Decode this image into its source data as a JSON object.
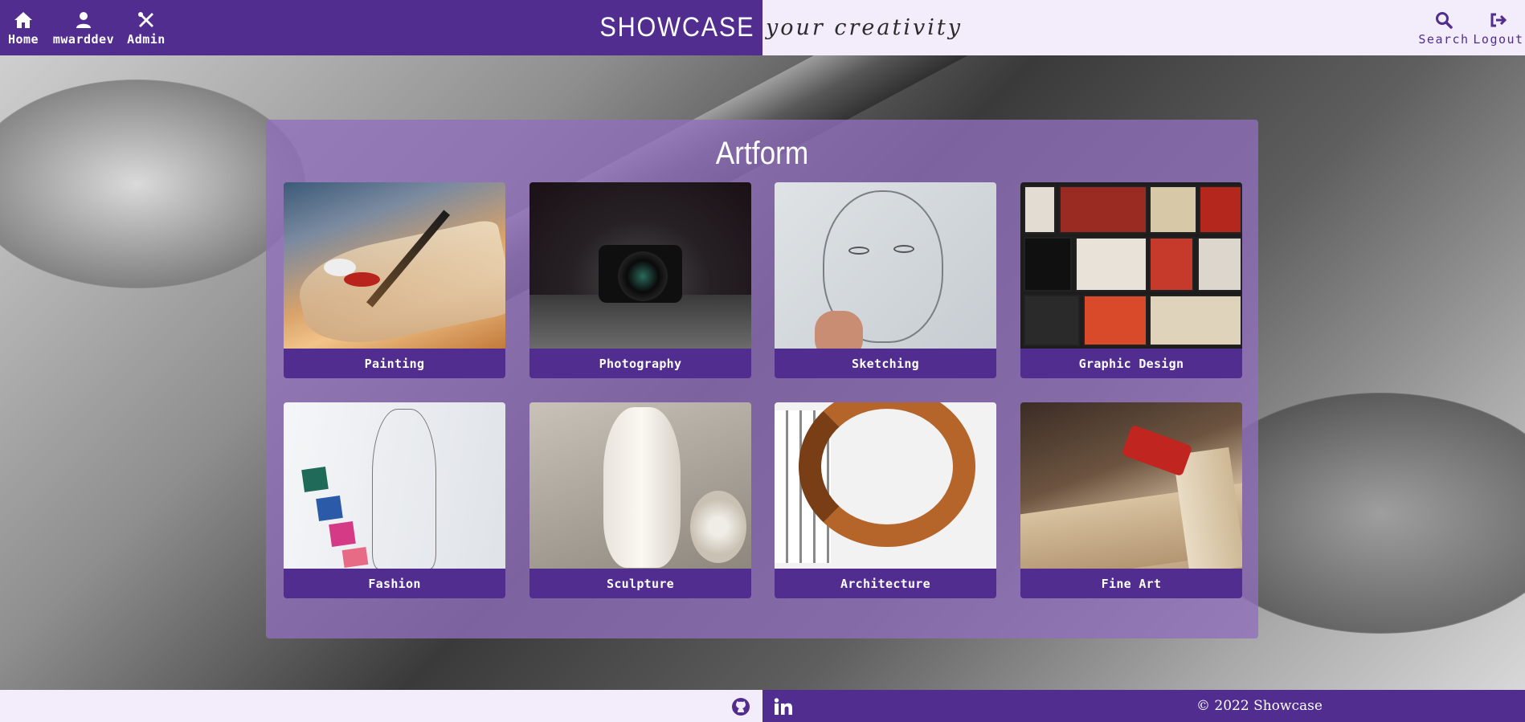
{
  "nav": {
    "home_label": "Home",
    "user_label": "mwarddev",
    "admin_label": "Admin",
    "brand": "SHOWCASE",
    "tagline": "your creativity",
    "search_label": "Search",
    "logout_label": "Logout"
  },
  "panel": {
    "title": "Artform",
    "cards": [
      {
        "label": "Painting",
        "icon": "painting-image"
      },
      {
        "label": "Photography",
        "icon": "camera-image"
      },
      {
        "label": "Sketching",
        "icon": "sketch-image"
      },
      {
        "label": "Graphic Design",
        "icon": "posters-image"
      },
      {
        "label": "Fashion",
        "icon": "fashion-sketch-image"
      },
      {
        "label": "Sculpture",
        "icon": "sculpture-image"
      },
      {
        "label": "Architecture",
        "icon": "staircase-image"
      },
      {
        "label": "Fine Art",
        "icon": "woodwork-image"
      }
    ]
  },
  "footer": {
    "copyright": "© 2022 Showcase",
    "github_icon": "github-icon",
    "linkedin_icon": "linkedin-icon"
  },
  "colors": {
    "brand_purple": "#502d8f",
    "light_lavender": "#f3ecfb",
    "panel_overlay": "#916ebe"
  }
}
